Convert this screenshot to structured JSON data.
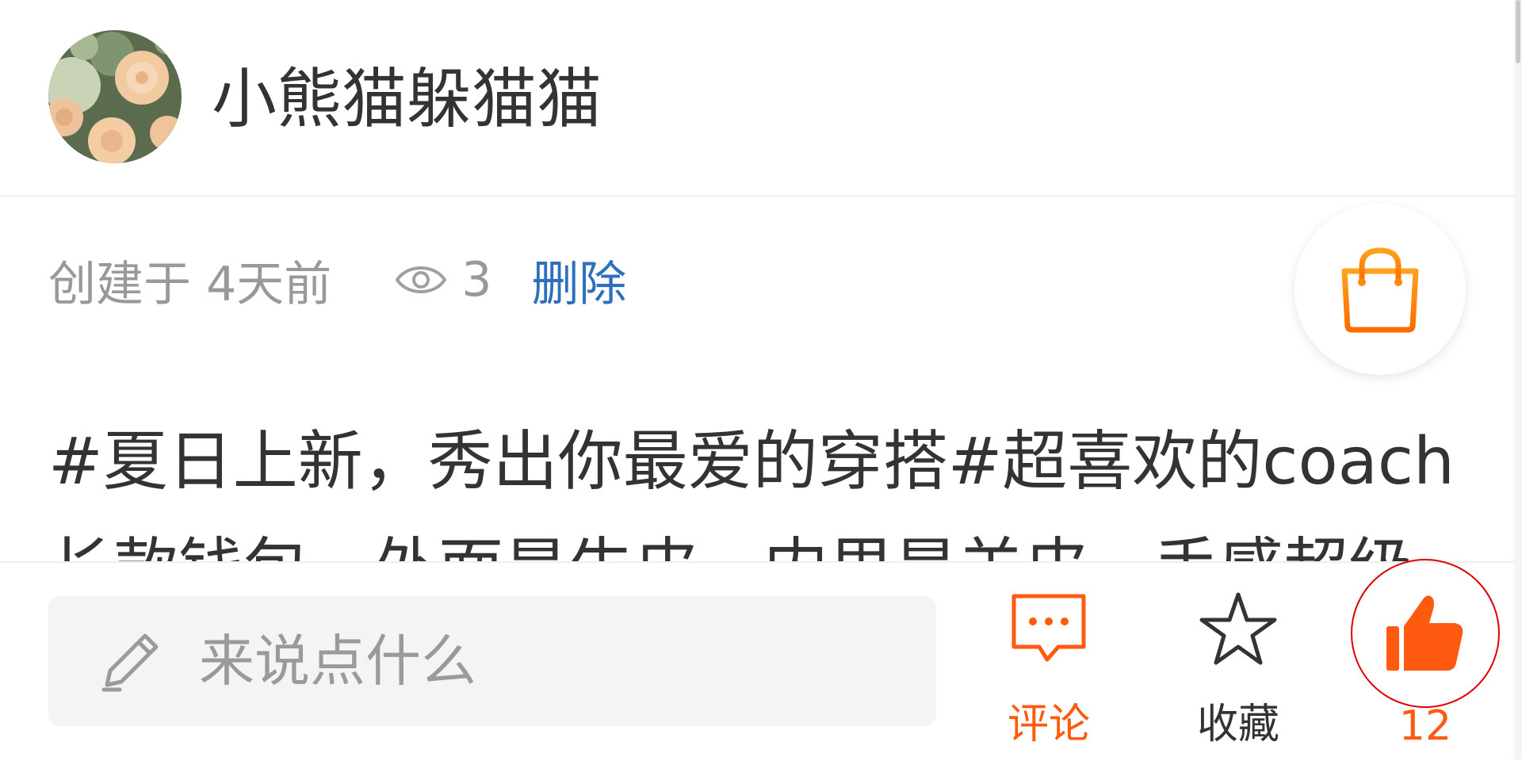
{
  "header": {
    "username": "小熊猫躲猫猫"
  },
  "meta": {
    "created": "创建于 4天前",
    "views": "3",
    "delete_label": "删除"
  },
  "post": {
    "content": "#夏日上新，秀出你最爱的穿搭#超喜欢的coach长款钱包，外面是牛皮，内里是羊皮，手感超级"
  },
  "bottom_bar": {
    "input_placeholder": "来说点什么",
    "comment_label": "评论",
    "favorite_label": "收藏",
    "like_count": "12"
  },
  "colors": {
    "accent": "#ff5a0f",
    "link": "#2d6fbd",
    "muted": "#999999",
    "highlight_ring": "#e00000"
  },
  "icons": [
    "avatar-image",
    "eye-icon",
    "shopping-bag-icon",
    "pencil-icon",
    "comment-icon",
    "star-icon",
    "thumbs-up-icon"
  ]
}
